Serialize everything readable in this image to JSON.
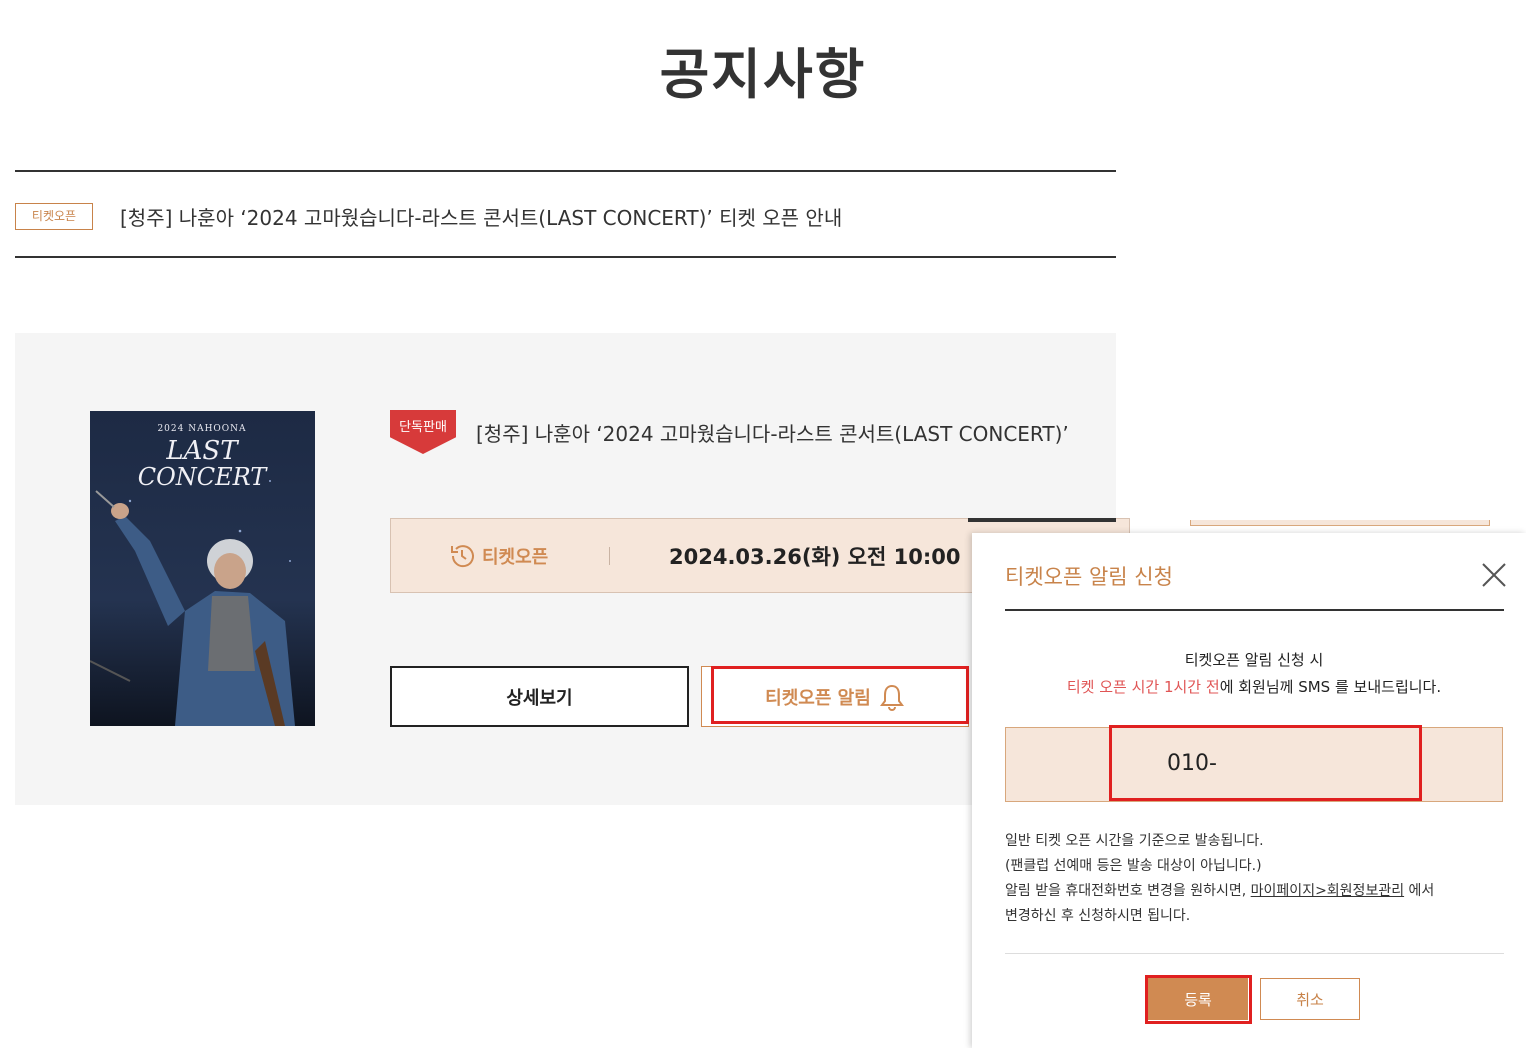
{
  "page": {
    "title": "공지사항"
  },
  "notice": {
    "badge": "티켓오픈",
    "title": "[청주] 나훈아 ‘2024 고마웠습니다-라스트 콘서트(LAST CONCERT)’ 티켓 오픈 안내"
  },
  "event": {
    "badge": "단독판매",
    "title": "[청주] 나훈아 ‘2024 고마웠습니다-라스트 콘서트(LAST CONCERT)’",
    "poster_text": {
      "top": "2024 NAHOONA",
      "line1": "LAST",
      "line2": "CONCERT"
    },
    "open_label": "티켓오픈",
    "open_date": "2024.03.26(화) 오전 10:00",
    "detail_button": "상세보기",
    "alarm_button": "티켓오픈 알림"
  },
  "modal": {
    "title": "티켓오픈 알림 신청",
    "desc1": "티켓오픈 알림 신청 시",
    "desc2_red": "티켓 오픈 시간 1시간 전",
    "desc2_rest": "에 회원님께 SMS 를 보내드립니다.",
    "phone_value": "010-",
    "note1": "일반 티켓 오픈 시간을 기준으로 발송됩니다.",
    "note2": "(팬클럽 선예매 등은 발송 대상이 아닙니다.)",
    "note3_pre": "알림 받을 휴대전화번호 변경을 원하시면, ",
    "note3_link": "마이페이지>회원정보관리",
    "note3_post": " 에서",
    "note4": "변경하신 후 신청하시면 됩니다.",
    "register_button": "등록",
    "cancel_button": "취소"
  },
  "colors": {
    "accent": "#d08a52",
    "accent_bg": "#f6e6da",
    "highlight": "#e02020",
    "badge_red": "#d73a3a"
  },
  "icons": [
    "history-icon",
    "bell-icon",
    "close-icon"
  ]
}
